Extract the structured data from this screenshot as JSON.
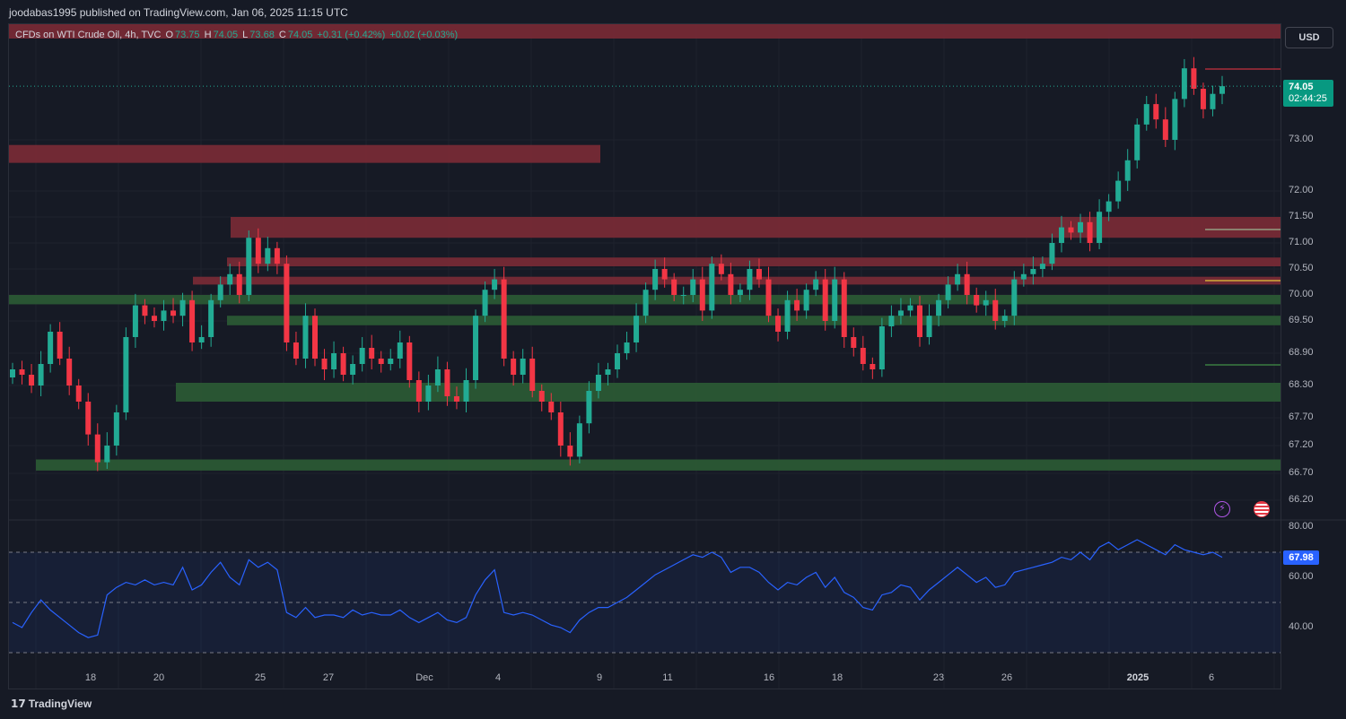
{
  "header": {
    "publisher_text": "joodabas1995 published on TradingView.com, Jan 06, 2025 11:15 UTC"
  },
  "legend": {
    "symbol": "CFDs on WTI Crude Oil, 4h, TVC",
    "o_label": "O",
    "o_value": "73.75",
    "h_label": "H",
    "h_value": "74.05",
    "l_label": "L",
    "l_value": "73.68",
    "c_label": "C",
    "c_value": "74.05",
    "change": "+0.31 (+0.42%)",
    "change2": "+0.02 (+0.03%)"
  },
  "currency": "USD",
  "price_tag": {
    "price": "74.05",
    "countdown": "02:44:25"
  },
  "rsi_tag": "67.98",
  "brand": {
    "icon": "tradingview-logo-icon",
    "name": "TradingView"
  },
  "icons": {
    "bolt": "lightning-bolt-icon",
    "flag": "us-flag-icon"
  },
  "colors": {
    "up": "#22ab94",
    "down": "#f23645",
    "rsi": "#2962ff",
    "resistance_zone": "#7a2a35",
    "support_zone": "#2b5a34",
    "background": "#161a25"
  },
  "chart_data": [
    {
      "type": "candlestick",
      "title": "CFDs on WTI Crude Oil, 4h, TVC",
      "y_axis_labels": [
        "73.00",
        "72.00",
        "71.50",
        "71.00",
        "70.50",
        "70.00",
        "69.50",
        "68.90",
        "68.30",
        "67.70",
        "67.20",
        "66.70",
        "66.20"
      ],
      "x_axis_labels": [
        "18",
        "20",
        "25",
        "27",
        "Dec",
        "4",
        "9",
        "11",
        "16",
        "18",
        "23",
        "26",
        "2025",
        "6"
      ],
      "last_price": 74.05,
      "zones": [
        {
          "kind": "resistance",
          "low": 71.1,
          "high": 71.5
        },
        {
          "kind": "resistance",
          "low": 70.55,
          "high": 70.72
        },
        {
          "kind": "resistance",
          "low": 70.2,
          "high": 70.35
        },
        {
          "kind": "resistance",
          "low": 72.55,
          "high": 72.9
        },
        {
          "kind": "support",
          "low": 69.82,
          "high": 70.0
        },
        {
          "kind": "support",
          "low": 69.42,
          "high": 69.6
        },
        {
          "kind": "support",
          "low": 68.0,
          "high": 68.35
        },
        {
          "kind": "support",
          "low": 66.75,
          "high": 66.95
        }
      ],
      "closes": [
        68.6,
        68.5,
        68.3,
        68.7,
        69.3,
        68.8,
        68.3,
        68.0,
        67.4,
        66.9,
        67.2,
        67.8,
        69.2,
        69.8,
        69.6,
        69.5,
        69.7,
        69.6,
        69.9,
        69.1,
        69.2,
        69.9,
        70.2,
        70.4,
        70.0,
        71.1,
        70.6,
        70.9,
        70.6,
        69.1,
        68.8,
        69.6,
        68.8,
        68.6,
        68.9,
        68.5,
        68.7,
        69.0,
        68.8,
        68.7,
        68.8,
        69.1,
        68.4,
        68.0,
        68.3,
        68.6,
        68.1,
        68.0,
        68.4,
        69.6,
        70.1,
        70.3,
        68.8,
        68.5,
        68.8,
        68.2,
        68.0,
        67.8,
        67.2,
        67.0,
        67.6,
        68.2,
        68.5,
        68.6,
        68.9,
        69.1,
        69.6,
        70.1,
        70.5,
        70.3,
        70.0,
        70.0,
        70.3,
        69.7,
        70.6,
        70.4,
        70.0,
        70.1,
        70.5,
        70.3,
        69.6,
        69.3,
        69.9,
        69.7,
        70.1,
        70.3,
        69.5,
        70.3,
        69.2,
        69.0,
        68.7,
        68.6,
        69.4,
        69.6,
        69.7,
        69.8,
        69.2,
        69.6,
        69.9,
        70.2,
        70.4,
        70.0,
        69.8,
        69.9,
        69.5,
        69.6,
        70.3,
        70.4,
        70.5,
        70.6,
        71.0,
        71.3,
        71.2,
        71.4,
        71.0,
        71.6,
        71.8,
        72.2,
        72.6,
        73.3,
        73.7,
        73.4,
        73.0,
        73.8,
        74.4,
        74.0,
        73.6,
        73.9,
        74.05
      ],
      "rsi": {
        "name": "RSI",
        "y_axis_labels": [
          "80.00",
          "60.00",
          "40.00"
        ],
        "bands": [
          70,
          30
        ],
        "last": 67.98,
        "values": [
          42,
          40,
          46,
          51,
          47,
          44,
          41,
          38,
          36,
          37,
          53,
          56,
          58,
          57,
          59,
          57,
          58,
          57,
          64,
          55,
          57,
          62,
          66,
          60,
          57,
          67,
          64,
          66,
          63,
          46,
          44,
          48,
          44,
          45,
          45,
          44,
          47,
          45,
          46,
          45,
          45,
          47,
          44,
          42,
          44,
          46,
          43,
          42,
          44,
          53,
          59,
          63,
          46,
          45,
          46,
          45,
          43,
          41,
          40,
          38,
          43,
          46,
          48,
          48,
          50,
          52,
          55,
          58,
          61,
          63,
          65,
          67,
          69,
          68,
          70,
          68,
          62,
          64,
          64,
          62,
          58,
          55,
          58,
          57,
          60,
          62,
          56,
          60,
          54,
          52,
          48,
          47,
          53,
          54,
          57,
          56,
          51,
          55,
          58,
          61,
          64,
          61,
          58,
          60,
          56,
          57,
          62,
          63,
          64,
          65,
          66,
          68,
          67,
          70,
          67,
          72,
          74,
          71,
          73,
          75,
          73,
          71,
          69,
          73,
          71,
          70,
          69,
          70,
          68
        ]
      }
    }
  ]
}
